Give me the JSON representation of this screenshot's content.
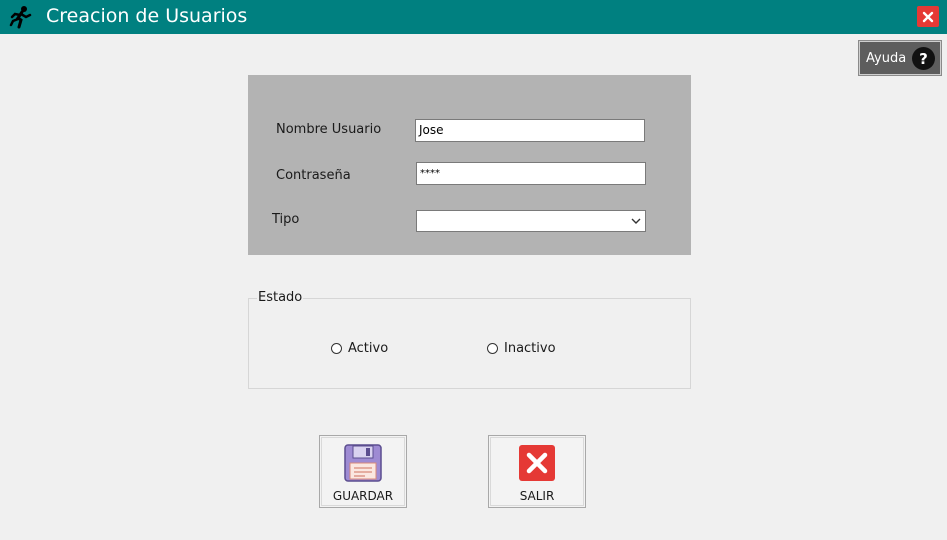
{
  "window": {
    "title": "Creacion de Usuarios",
    "app_icon": "running-person-icon",
    "close_icon": "close-icon",
    "titlebar_color": "#008080"
  },
  "help": {
    "label": "Ayuda",
    "icon_glyph": "?"
  },
  "form": {
    "username": {
      "label": "Nombre Usuario",
      "value": "Jose"
    },
    "password": {
      "label": "Contraseña",
      "value": "****"
    },
    "type": {
      "label": "Tipo",
      "value": ""
    }
  },
  "status": {
    "legend": "Estado",
    "options": [
      {
        "label": "Activo",
        "selected": false
      },
      {
        "label": "Inactivo",
        "selected": false
      }
    ]
  },
  "actions": {
    "save": {
      "label": "GUARDAR",
      "icon": "floppy-disk-icon"
    },
    "exit": {
      "label": "SALIR",
      "icon": "close-x-icon"
    }
  }
}
